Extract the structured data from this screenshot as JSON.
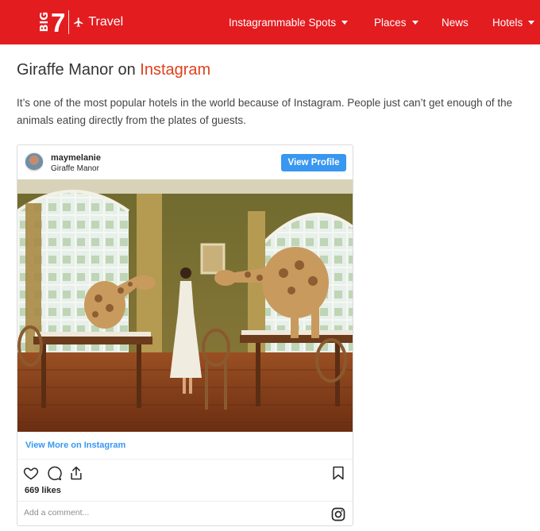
{
  "header": {
    "logo": {
      "big": "BIG",
      "number": "7",
      "travel": "Travel",
      "icon": "plane-icon"
    },
    "nav": [
      {
        "label": "Instagrammable Spots",
        "has_dropdown": true
      },
      {
        "label": "Places",
        "has_dropdown": true
      },
      {
        "label": "News",
        "has_dropdown": false
      },
      {
        "label": "Hotels",
        "has_dropdown": true
      }
    ],
    "background_color": "#e31c20"
  },
  "article": {
    "title_prefix": "Giraffe Manor on ",
    "title_accent": "Instagram",
    "accent_color": "#e0401c",
    "body": "It’s one of the most popular hotels in the world because of Instagram. People just can’t get enough of the animals eating directly from the plates of guests."
  },
  "instagram_post": {
    "username": "maymelanie",
    "location": "Giraffe Manor",
    "view_profile_label": "View Profile",
    "view_more_label": "View More on Instagram",
    "likes": "669 likes",
    "comment_placeholder": "Add a comment...",
    "icons": [
      "heart-icon",
      "comment-icon",
      "share-icon",
      "bookmark-icon",
      "instagram-logo-icon"
    ],
    "button_color": "#3897f0"
  }
}
